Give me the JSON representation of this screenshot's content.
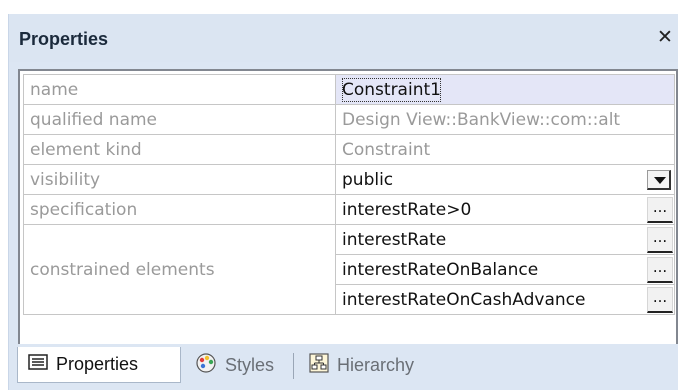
{
  "panel": {
    "title": "Properties"
  },
  "properties": [
    {
      "name": "name",
      "value": "Constraint1",
      "readonly": false,
      "control": "none",
      "selected": true
    },
    {
      "name": "qualified name",
      "value": "Design View::BankView::com::alt",
      "readonly": true,
      "control": "none"
    },
    {
      "name": "element kind",
      "value": "Constraint",
      "readonly": true,
      "control": "none"
    },
    {
      "name": "visibility",
      "value": "public",
      "readonly": false,
      "control": "dropdown"
    },
    {
      "name": "specification",
      "value": "interestRate>0",
      "readonly": false,
      "control": "ellipsis"
    }
  ],
  "constrained": {
    "name": "constrained elements",
    "values": [
      "interestRate",
      "interestRateOnBalance",
      "interestRateOnCashAdvance"
    ]
  },
  "button_text": "...",
  "tabs": [
    {
      "label": "Properties",
      "icon": "list-icon",
      "active": true
    },
    {
      "label": "Styles",
      "icon": "palette-icon",
      "active": false
    },
    {
      "label": "Hierarchy",
      "icon": "hierarchy-icon",
      "active": false
    }
  ]
}
